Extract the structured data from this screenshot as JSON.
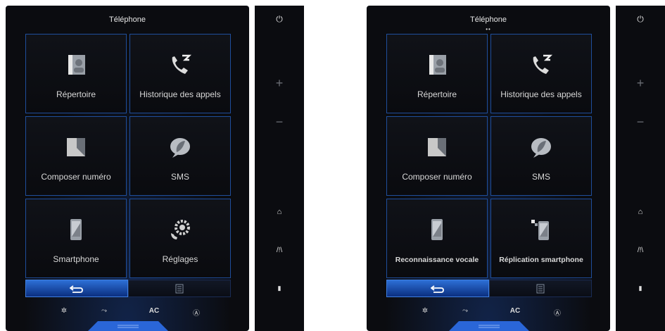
{
  "screens": [
    {
      "title": "Téléphone",
      "page_dots": "",
      "tiles": [
        {
          "label": "Répertoire",
          "icon": "contacts-icon"
        },
        {
          "label": "Historique des appels",
          "icon": "call-history-icon"
        },
        {
          "label": "Composer numéro",
          "icon": "dial-number-icon"
        },
        {
          "label": "SMS",
          "icon": "sms-icon"
        },
        {
          "label": "Smartphone",
          "icon": "smartphone-icon"
        },
        {
          "label": "Réglages",
          "icon": "settings-icon"
        }
      ],
      "bottom": {
        "back_icon": "back-arrow-icon",
        "list_icon": "list-icon"
      },
      "climate": {
        "fan_icon": "fan-icon",
        "seat_icon": "air-flow-icon",
        "ac": "AC",
        "auto_icon": "auto-climate-icon"
      },
      "side": {
        "power_icon": "power-icon",
        "plus": "+",
        "minus": "−",
        "home_icon": "home-icon",
        "nav_icon": "navigation-icon",
        "phone_icon": "phone-mode-icon"
      }
    },
    {
      "title": "Téléphone",
      "page_dots": "••",
      "tiles": [
        {
          "label": "Répertoire",
          "icon": "contacts-icon"
        },
        {
          "label": "Historique des appels",
          "icon": "call-history-icon"
        },
        {
          "label": "Composer numéro",
          "icon": "dial-number-icon"
        },
        {
          "label": "SMS",
          "icon": "sms-icon"
        },
        {
          "label": "Reconnaissance vocale",
          "icon": "smartphone-icon"
        },
        {
          "label": "Réplication smartphone",
          "icon": "smartphone-replication-icon"
        }
      ],
      "bottom": {
        "back_icon": "back-arrow-icon",
        "list_icon": "list-icon"
      },
      "climate": {
        "fan_icon": "fan-icon",
        "seat_icon": "air-flow-icon",
        "ac": "AC",
        "auto_icon": "auto-climate-icon"
      },
      "side": {
        "power_icon": "power-icon",
        "plus": "+",
        "minus": "−",
        "home_icon": "home-icon",
        "nav_icon": "navigation-icon",
        "phone_icon": "phone-mode-icon"
      }
    }
  ]
}
